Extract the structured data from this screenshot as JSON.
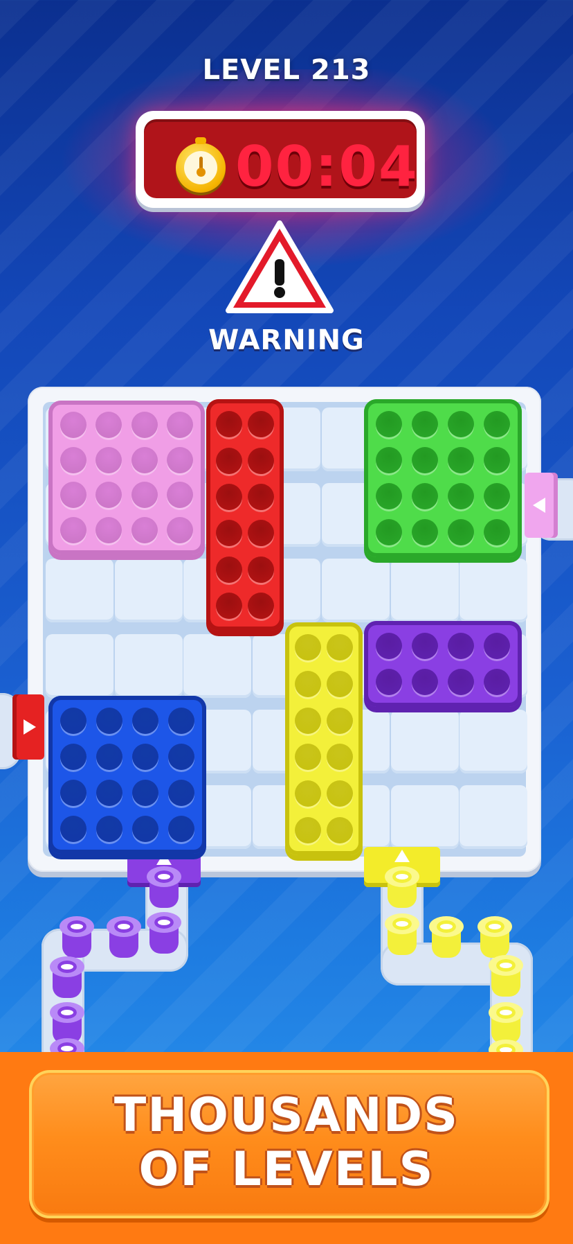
{
  "level_title": "LEVEL 213",
  "timer": {
    "value": "00:04",
    "icon": "stopwatch-icon"
  },
  "warning": {
    "label": "WARNING",
    "icon": "warning-triangle-icon"
  },
  "board": {
    "pieces": [
      {
        "name": "pink-block",
        "color": "#f09ee6",
        "shade": "#c974c4",
        "hole": "#d97fd6"
      },
      {
        "name": "red-block",
        "color": "#ee2a2a",
        "shade": "#b51313",
        "hole": "#9c0f10"
      },
      {
        "name": "green-block",
        "color": "#4fdc4a",
        "shade": "#2aa82a",
        "hole": "#239a22"
      },
      {
        "name": "purple-block",
        "color": "#8a3fe3",
        "shade": "#5f22b0",
        "hole": "#5a1da3"
      },
      {
        "name": "yellow-block",
        "color": "#f3f03a",
        "shade": "#c8c20e",
        "hole": "#c9c41a"
      },
      {
        "name": "blue-block",
        "color": "#1d56e8",
        "shade": "#1237a8",
        "hole": "#123aa6"
      }
    ],
    "gates": [
      {
        "name": "pink-gate",
        "color": "#f0a6ee",
        "direction": "left"
      },
      {
        "name": "red-gate",
        "color": "#e52222",
        "direction": "right"
      },
      {
        "name": "purple-gate",
        "color": "#8a3fe3",
        "direction": "up"
      },
      {
        "name": "yellow-gate",
        "color": "#f3ec2a",
        "direction": "up"
      }
    ]
  },
  "cups": {
    "purple": {
      "color": "#8a3fe3",
      "rim": "#b98af7",
      "core": "#ffffff",
      "symbol": "heart"
    },
    "yellow": {
      "color": "#f3f03a",
      "rim": "#fbf98c",
      "core": "#ffffff",
      "symbol": "drop"
    }
  },
  "banner": {
    "line1": "THOUSANDS",
    "line2": "OF LEVELS"
  }
}
